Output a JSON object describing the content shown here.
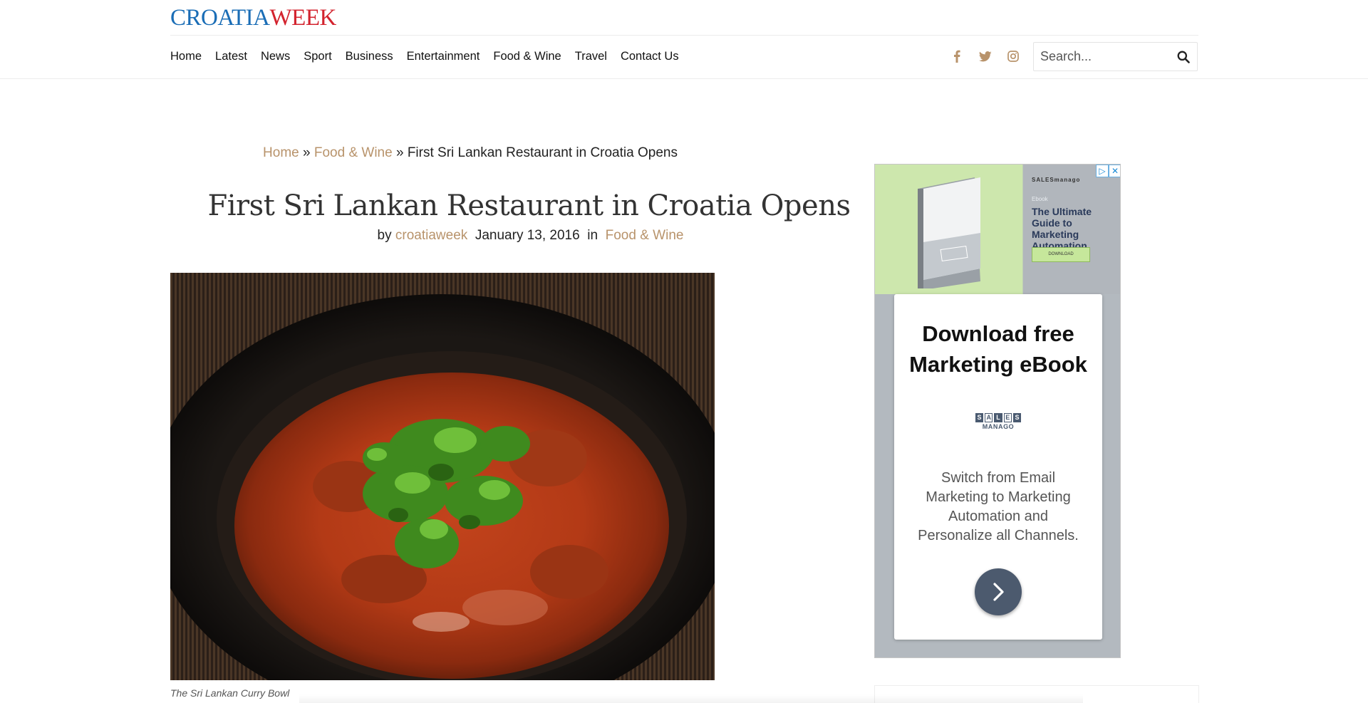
{
  "site": {
    "logo_part1": "CROATIA",
    "logo_part2": "WEEK"
  },
  "nav": {
    "items": [
      "Home",
      "Latest",
      "News",
      "Sport",
      "Business",
      "Entertainment",
      "Food & Wine",
      "Travel",
      "Contact Us"
    ]
  },
  "social": {
    "icons": [
      "facebook-icon",
      "twitter-icon",
      "instagram-icon"
    ],
    "color": "#b8936b"
  },
  "search": {
    "placeholder": "Search..."
  },
  "breadcrumb": {
    "home": "Home",
    "sep": "»",
    "category": "Food & Wine",
    "current": "First Sri Lankan Restaurant in Croatia Opens"
  },
  "article": {
    "title": "First Sri Lankan Restaurant in Croatia Opens",
    "by_label": "by",
    "author": "croatiaweek",
    "date": "January 13, 2016",
    "in_label": "in",
    "category": "Food & Wine",
    "caption": "The Sri Lankan Curry Bowl"
  },
  "ad": {
    "brand": "SALESmanago",
    "small_label": "Ebook",
    "small_headline": "The Ultimate Guide to Marketing Automation",
    "small_download": "DOWNLOAD",
    "card_title": "Download free Marketing eBook",
    "logo_letters": [
      "S",
      "A",
      "L",
      "E",
      "S"
    ],
    "logo_sub": "MANAGO",
    "body": "Switch from Email Marketing to Marketing Automation and Personalize all Channels.",
    "book_title": "The Ultimate Guide to Marketing Automation",
    "book_badge": "Ebook"
  },
  "colors": {
    "accent": "#b8936b",
    "logo_blue": "#1a6db6",
    "logo_red": "#d3232e"
  }
}
